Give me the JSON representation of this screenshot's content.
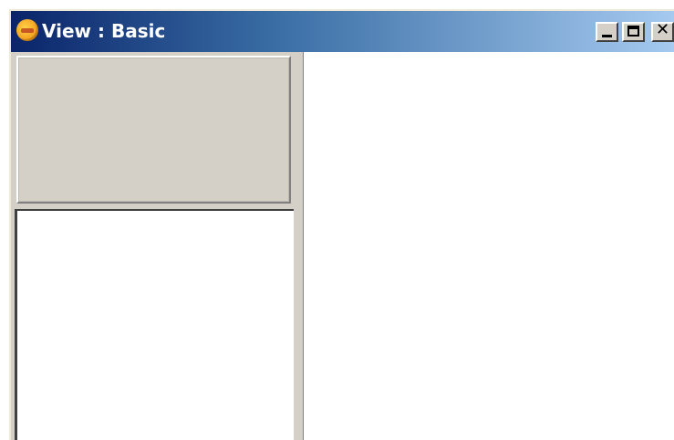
{
  "window": {
    "title": "View : Basic",
    "app_icon": "orange-ball-app-icon",
    "controls": {
      "minimize": "minimize-icon",
      "maximize": "maximize-icon",
      "close": "close-icon",
      "close_glyph": "✕"
    }
  },
  "colors": {
    "titlebar_start": "#0a246a",
    "titlebar_end": "#a6caf0",
    "face": "#d4d0c8",
    "panel_bg": "#ffffff"
  }
}
